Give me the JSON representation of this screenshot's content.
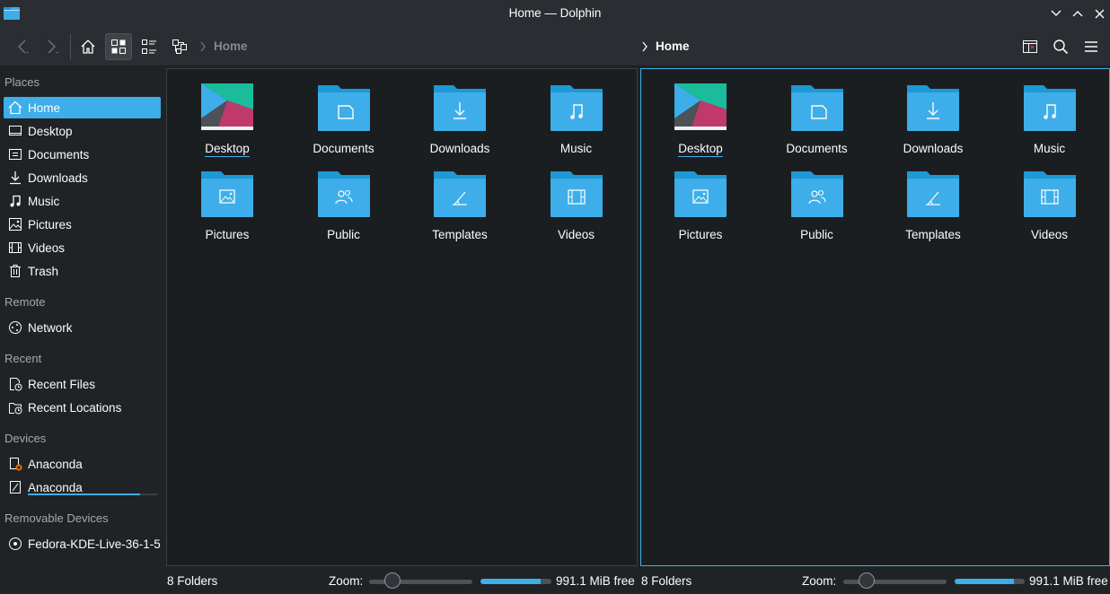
{
  "window": {
    "title": "Home — Dolphin"
  },
  "toolbar": {
    "breadcrumb_left": "Home",
    "breadcrumb_right": "Home"
  },
  "sidebar": {
    "sections": {
      "places": "Places",
      "remote": "Remote",
      "recent": "Recent",
      "devices": "Devices",
      "removable": "Removable Devices"
    },
    "places": [
      {
        "label": "Home",
        "icon": "home-icon"
      },
      {
        "label": "Desktop",
        "icon": "desktop-icon"
      },
      {
        "label": "Documents",
        "icon": "documents-icon"
      },
      {
        "label": "Downloads",
        "icon": "downloads-icon"
      },
      {
        "label": "Music",
        "icon": "music-icon"
      },
      {
        "label": "Pictures",
        "icon": "pictures-icon"
      },
      {
        "label": "Videos",
        "icon": "videos-icon"
      },
      {
        "label": "Trash",
        "icon": "trash-icon"
      }
    ],
    "remote": [
      {
        "label": "Network",
        "icon": "network-icon"
      }
    ],
    "recent": [
      {
        "label": "Recent Files",
        "icon": "recent-files-icon"
      },
      {
        "label": "Recent Locations",
        "icon": "recent-locations-icon"
      }
    ],
    "devices": [
      {
        "label": "Anaconda",
        "icon": "drive-error-icon"
      },
      {
        "label": "Anaconda",
        "icon": "drive-icon"
      }
    ],
    "removable": [
      {
        "label": "Fedora-KDE-Live-36-1-5",
        "icon": "optical-disc-icon"
      }
    ]
  },
  "panes": [
    {
      "items": [
        "Desktop",
        "Documents",
        "Downloads",
        "Music",
        "Pictures",
        "Public",
        "Templates",
        "Videos"
      ],
      "status": {
        "count": "8 Folders",
        "zoom_label": "Zoom:",
        "free_space": "991.1 MiB free",
        "zoom_level": 0.15,
        "used_fraction": 0.85
      }
    },
    {
      "items": [
        "Desktop",
        "Documents",
        "Downloads",
        "Music",
        "Pictures",
        "Public",
        "Templates",
        "Videos"
      ],
      "status": {
        "count": "8 Folders",
        "zoom_label": "Zoom:",
        "free_space": "991.1 MiB free",
        "zoom_level": 0.15,
        "used_fraction": 0.85
      }
    }
  ],
  "colors": {
    "accent": "#3daee9",
    "folder_body": "#3daee9",
    "folder_tab": "#1d99d6",
    "background": "#202326",
    "view_background": "#1b1e20"
  }
}
